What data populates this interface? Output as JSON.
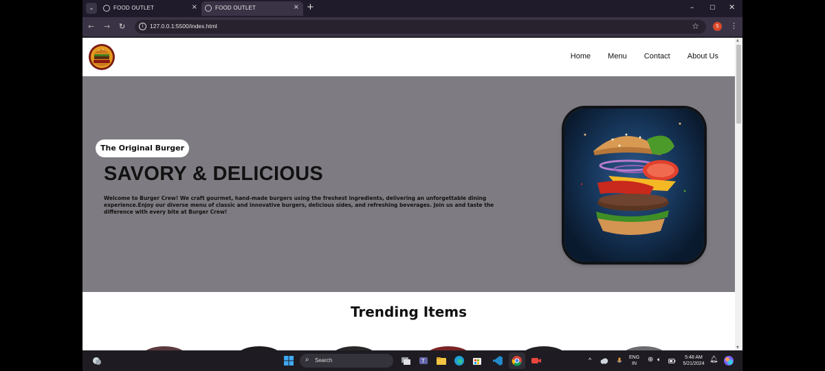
{
  "browser": {
    "tabs": [
      {
        "title": "FOOD OUTLET",
        "active": false
      },
      {
        "title": "FOOD OUTLET",
        "active": true
      }
    ],
    "new_tab_glyph": "+",
    "close_glyph": "×",
    "url": "127.0.0.1:5500/index.html",
    "profile_initial": "S",
    "window_controls": [
      "–",
      "▢",
      "✕"
    ]
  },
  "site": {
    "nav": [
      "Home",
      "Menu",
      "Contact",
      "About Us"
    ],
    "hero": {
      "tag": "The Original Burger",
      "title": "SAVORY & DELICIOUS",
      "description": "Welcome to Burger Crew! We craft gourmet, hand-made burgers using the freshest ingredients, delivering an unforgettable dining experience.Enjoy our diverse menu of classic and innovative burgers, delicious sides, and refreshing beverages. Join us and taste the difference with every bite at Burger Crew!",
      "background": "#7e7c82"
    },
    "trending_title": "Trending Items"
  },
  "taskbar": {
    "search_label": "Search",
    "language": "ENG",
    "region": "IN",
    "time": "5:48 AM",
    "date": "5/21/2024"
  },
  "colors": {
    "browser_tabbar": "#1f1b2b",
    "browser_toolbar": "#3a3346",
    "taskbar": "#1e1c22",
    "profile": "#d9482a"
  }
}
